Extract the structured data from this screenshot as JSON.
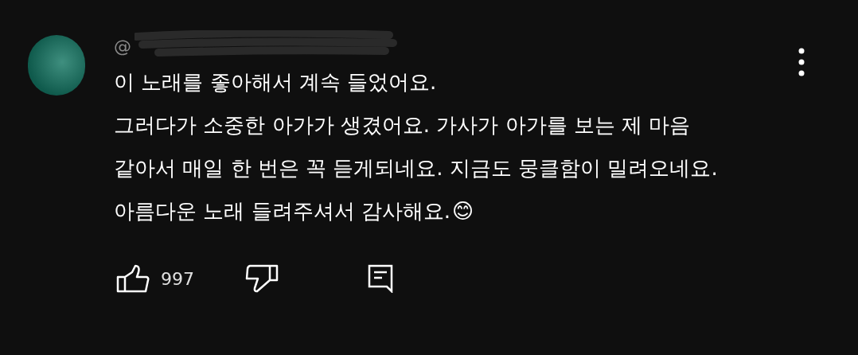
{
  "comment": {
    "author_prefix": "@",
    "lines": [
      "이 노래를 좋아해서 계속 들었어요.",
      "그러다가 소중한 아가가 생겼어요. 가사가 아가를 보는 제 마음",
      "같아서 매일 한 번은 꼭 듣게되네요. 지금도 뭉클함이 밀려오네요.",
      "아름다운 노래 들려주셔서 감사해요."
    ],
    "emoji": "😊",
    "like_count": "997"
  }
}
